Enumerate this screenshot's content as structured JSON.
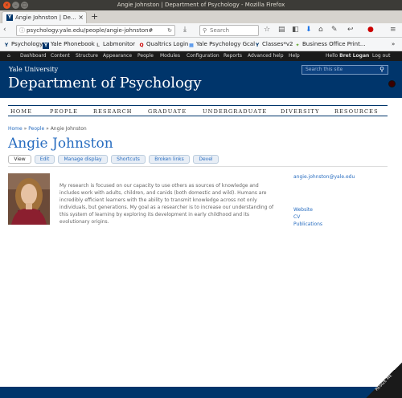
{
  "window": {
    "title": "Angie Johnston | Department of Psychology - Mozilla Firefox"
  },
  "tab": {
    "title": "Angie Johnston | De...",
    "favicon": "Y",
    "close": "×",
    "new_tab": "+"
  },
  "nav": {
    "url": "psychology.yale.edu/people/angie-johnston#",
    "search_placeholder": "Search"
  },
  "bookmarks": [
    {
      "icon": "Y",
      "label": "Psychology"
    },
    {
      "icon": "Y",
      "label": "Yale Phonebook"
    },
    {
      "icon": "L",
      "label": "Labmonitor"
    },
    {
      "icon": "Q",
      "label": "Qualtrics Login"
    },
    {
      "icon": "▦",
      "label": "Yale Psychology Gcal"
    },
    {
      "icon": "Y",
      "label": "Classes*v2"
    },
    {
      "icon": "✦",
      "label": "Business Office Print..."
    }
  ],
  "admin": {
    "items": [
      "Dashboard",
      "Content",
      "Structure",
      "Appearance",
      "People",
      "Modules",
      "Configuration",
      "Reports",
      "Advanced help",
      "Help"
    ],
    "hello": "Hello",
    "user": "Bret Logan",
    "logout": "Log out"
  },
  "site": {
    "university": "Yale University",
    "department": "Department of Psychology",
    "search_placeholder": "Search this site"
  },
  "main_nav": [
    "HOME",
    "PEOPLE",
    "RESEARCH",
    "GRADUATE",
    "UNDERGRADUATE",
    "DIVERSITY",
    "RESOURCES"
  ],
  "breadcrumb": {
    "home": "Home",
    "sep1": "»",
    "people": "People",
    "sep2": "»",
    "current": "Angie Johnston"
  },
  "person": {
    "name": "Angie Johnston",
    "email": "angie.johnston@yale.edu",
    "bio": "My research is focused on our capacity to use others as sources of knowledge and includes work with adults, children, and canids (both domestic and wild). Humans are incredibly efficient learners with the ability to transmit knowledge across not only individuals, but generations. My goal as a researcher is to increase our understanding of this system of learning by exploring its development in early childhood and its evolutionary origins.",
    "links": [
      "Website",
      "CV",
      "Publications"
    ]
  },
  "page_tabs": [
    "View",
    "Edit",
    "Manage display",
    "Shortcuts",
    "Broken links",
    "Devel"
  ],
  "resize_label": "RESIZE ME",
  "colors": {
    "yale_blue": "#00356b",
    "link": "#286dc0",
    "admin_bar": "#1a1a1a"
  }
}
